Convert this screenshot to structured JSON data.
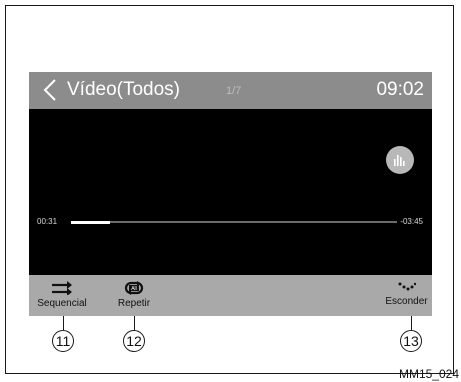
{
  "header": {
    "title": "Vídeo(Todos)",
    "track_counter": "1/7",
    "clock": "09:02"
  },
  "player": {
    "time_elapsed": "00:31",
    "time_remaining": "-03:45",
    "progress_fraction": 0.12
  },
  "toolbar": {
    "items": [
      {
        "label": "Sequencial",
        "icon": "sequential-shuffle-icon"
      },
      {
        "label": "Repetir",
        "icon": "repeat-all-icon",
        "badge": "All"
      },
      {
        "label": "Esconder",
        "icon": "hide-dots-icon"
      }
    ]
  },
  "callouts": [
    "11",
    "12",
    "13"
  ],
  "figure_code": "MM15_024"
}
